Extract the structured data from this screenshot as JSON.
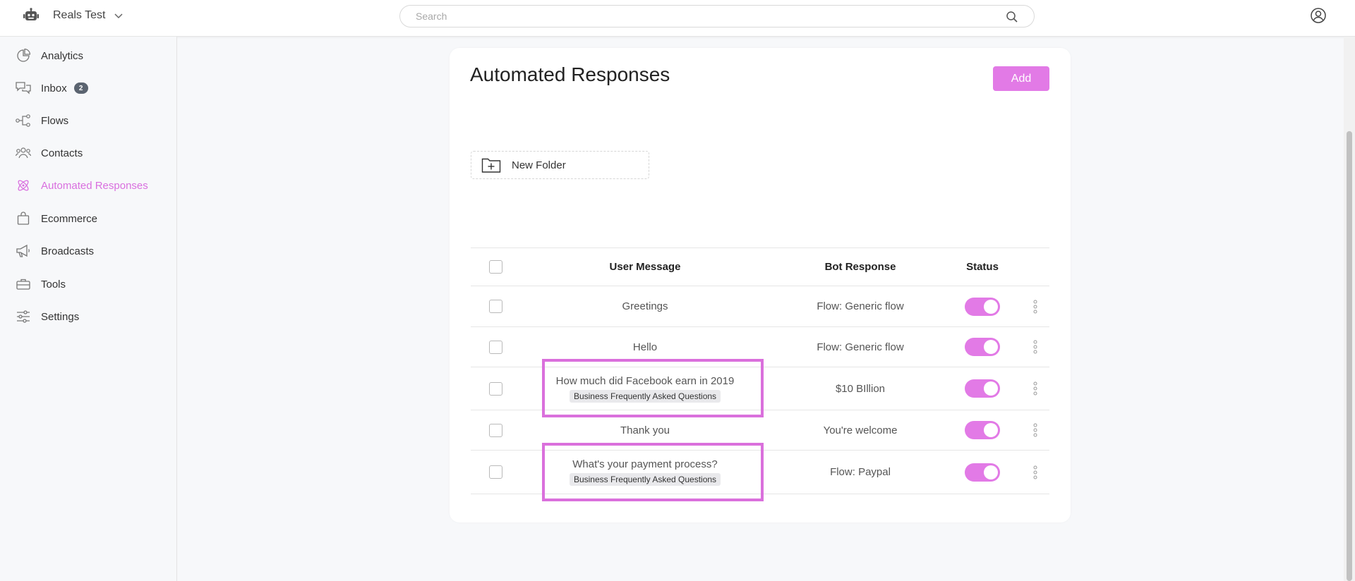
{
  "header": {
    "workspace_name": "Reals Test",
    "search_placeholder": "Search"
  },
  "sidebar": {
    "items": [
      {
        "label": "Analytics",
        "icon": "chart-pie-icon"
      },
      {
        "label": "Inbox",
        "icon": "chat-bubbles-icon",
        "badge": "2"
      },
      {
        "label": "Flows",
        "icon": "flow-nodes-icon"
      },
      {
        "label": "Contacts",
        "icon": "users-icon"
      },
      {
        "label": "Automated Responses",
        "icon": "atom-icon",
        "active": true
      },
      {
        "label": "Ecommerce",
        "icon": "shopping-bag-icon"
      },
      {
        "label": "Broadcasts",
        "icon": "megaphone-icon"
      },
      {
        "label": "Tools",
        "icon": "toolbox-icon"
      },
      {
        "label": "Settings",
        "icon": "sliders-icon"
      }
    ]
  },
  "main": {
    "title": "Automated Responses",
    "add_label": "Add",
    "new_folder_label": "New Folder",
    "table": {
      "headers": {
        "user_message": "User Message",
        "bot_response": "Bot Response",
        "status": "Status"
      },
      "rows": [
        {
          "user_message": "Greetings",
          "tag": "",
          "bot_response": "Flow: Generic flow",
          "status": "on"
        },
        {
          "user_message": "Hello",
          "tag": "",
          "bot_response": "Flow: Generic flow",
          "status": "on"
        },
        {
          "user_message": "How much did Facebook earn in 2019",
          "tag": "Business Frequently Asked Questions",
          "bot_response": "$10 BIllion",
          "status": "on"
        },
        {
          "user_message": "Thank you",
          "tag": "",
          "bot_response": "You're welcome",
          "status": "on"
        },
        {
          "user_message": "What's your payment process?",
          "tag": "Business Frequently Asked Questions",
          "bot_response": "Flow: Paypal",
          "status": "on"
        }
      ]
    }
  },
  "colors": {
    "accent": "#e27ae6",
    "active_nav": "#d96fdf",
    "highlight_border": "#da70dc",
    "badge_bg": "#5b6470"
  }
}
